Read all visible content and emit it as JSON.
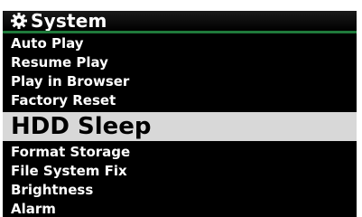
{
  "header": {
    "title": "System",
    "icon": "gear-icon"
  },
  "menu": {
    "items": [
      {
        "label": "Auto Play"
      },
      {
        "label": "Resume Play"
      },
      {
        "label": "Play in Browser"
      },
      {
        "label": "Factory Reset"
      },
      {
        "label": "HDD Sleep",
        "selected": true
      },
      {
        "label": "Format Storage"
      },
      {
        "label": "File System Fix"
      },
      {
        "label": "Brightness"
      },
      {
        "label": "Alarm"
      }
    ]
  },
  "colors": {
    "background": "#000000",
    "text": "#ffffff",
    "header_rule": "#1f7a3b",
    "selection_bg": "#d8d8d8",
    "selection_text": "#000000",
    "scroll_indicator": "#b01850"
  }
}
